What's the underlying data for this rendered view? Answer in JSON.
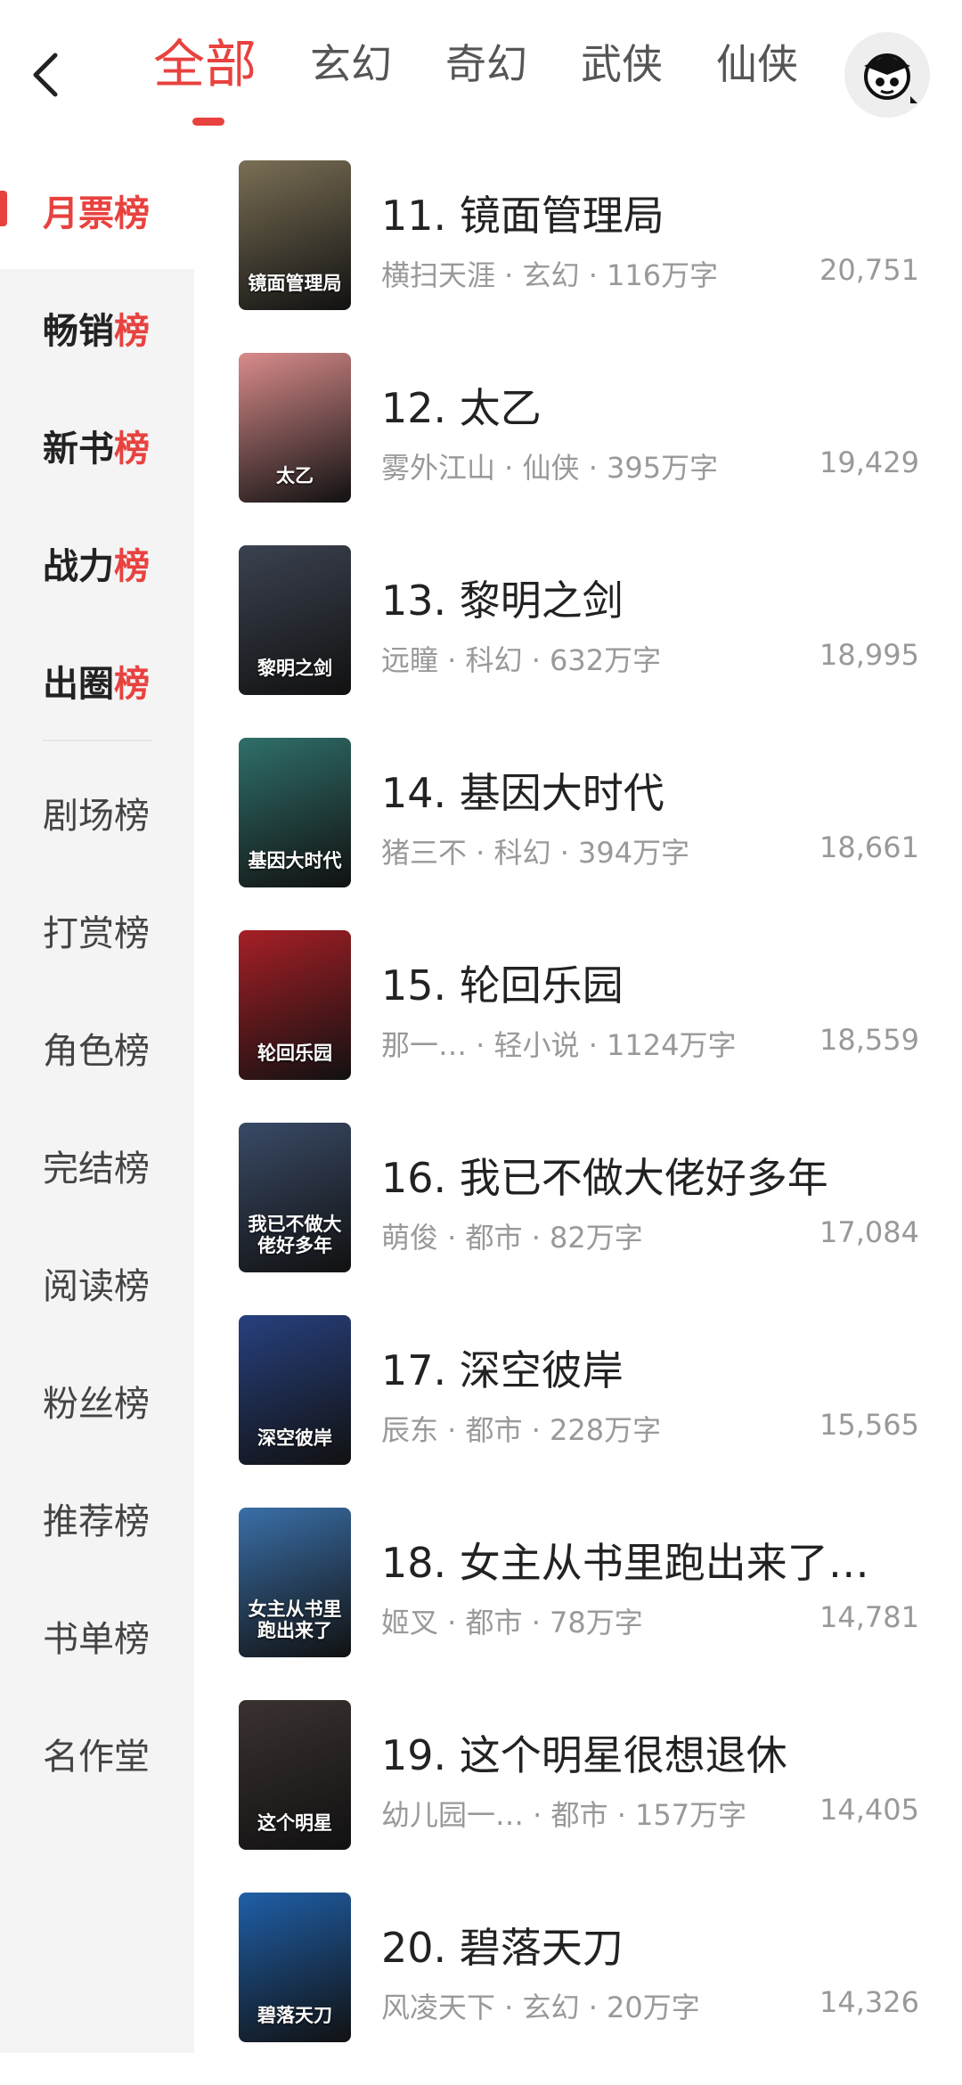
{
  "header": {
    "tabs": [
      "全部",
      "玄幻",
      "奇幻",
      "武侠",
      "仙侠"
    ]
  },
  "sidebar": {
    "items": [
      {
        "prefix": "月票",
        "suffix": "榜"
      },
      {
        "prefix": "畅销",
        "suffix": "榜"
      },
      {
        "prefix": "新书",
        "suffix": "榜"
      },
      {
        "prefix": "战力",
        "suffix": "榜"
      },
      {
        "prefix": "出圈",
        "suffix": "榜"
      },
      {
        "label": "剧场榜"
      },
      {
        "label": "打赏榜"
      },
      {
        "label": "角色榜"
      },
      {
        "label": "完结榜"
      },
      {
        "label": "阅读榜"
      },
      {
        "label": "粉丝榜"
      },
      {
        "label": "推荐榜"
      },
      {
        "label": "书单榜"
      },
      {
        "label": "名作堂"
      }
    ]
  },
  "books": [
    {
      "rank": "11. 镜面管理局",
      "cover_text": "镜面管理局",
      "meta": "横扫天涯 · 玄幻 · 116万字",
      "count": "20,751",
      "cover_color": "#7a6f55"
    },
    {
      "rank": "12. 太乙",
      "cover_text": "太乙",
      "meta": "雾外江山 · 仙侠 · 395万字",
      "count": "19,429",
      "cover_color": "#d98b8b"
    },
    {
      "rank": "13. 黎明之剑",
      "cover_text": "黎明之剑",
      "meta": "远瞳 · 科幻 · 632万字",
      "count": "18,995",
      "cover_color": "#3b4250"
    },
    {
      "rank": "14. 基因大时代",
      "cover_text": "基因大时代",
      "meta": "猪三不 · 科幻 · 394万字",
      "count": "18,661",
      "cover_color": "#2f6f6a"
    },
    {
      "rank": "15. 轮回乐园",
      "cover_text": "轮回乐园",
      "meta": "那一…   · 轻小说 · 1124万字",
      "count": "18,559",
      "cover_color": "#a61f26"
    },
    {
      "rank": "16. 我已不做大佬好多年",
      "cover_text": "我已不做大佬好多年",
      "meta": "萌俊 · 都市 · 82万字",
      "count": "17,084",
      "cover_color": "#394a66"
    },
    {
      "rank": "17. 深空彼岸",
      "cover_text": "深空彼岸",
      "meta": "辰东 · 都市 · 228万字",
      "count": "15,565",
      "cover_color": "#27407e"
    },
    {
      "rank": "18. 女主从书里跑出来了…",
      "cover_text": "女主从书里跑出来了",
      "meta": "姬叉 · 都市 · 78万字",
      "count": "14,781",
      "cover_color": "#3a6fa8"
    },
    {
      "rank": "19. 这个明星很想退休",
      "cover_text": "这个明星",
      "meta": "幼儿园一…   · 都市 · 157万字",
      "count": "14,405",
      "cover_color": "#3a3230"
    },
    {
      "rank": "20. 碧落天刀",
      "cover_text": "碧落天刀",
      "meta": "风凌天下 · 玄幻 · 20万字",
      "count": "14,326",
      "cover_color": "#1f5fa8"
    }
  ]
}
